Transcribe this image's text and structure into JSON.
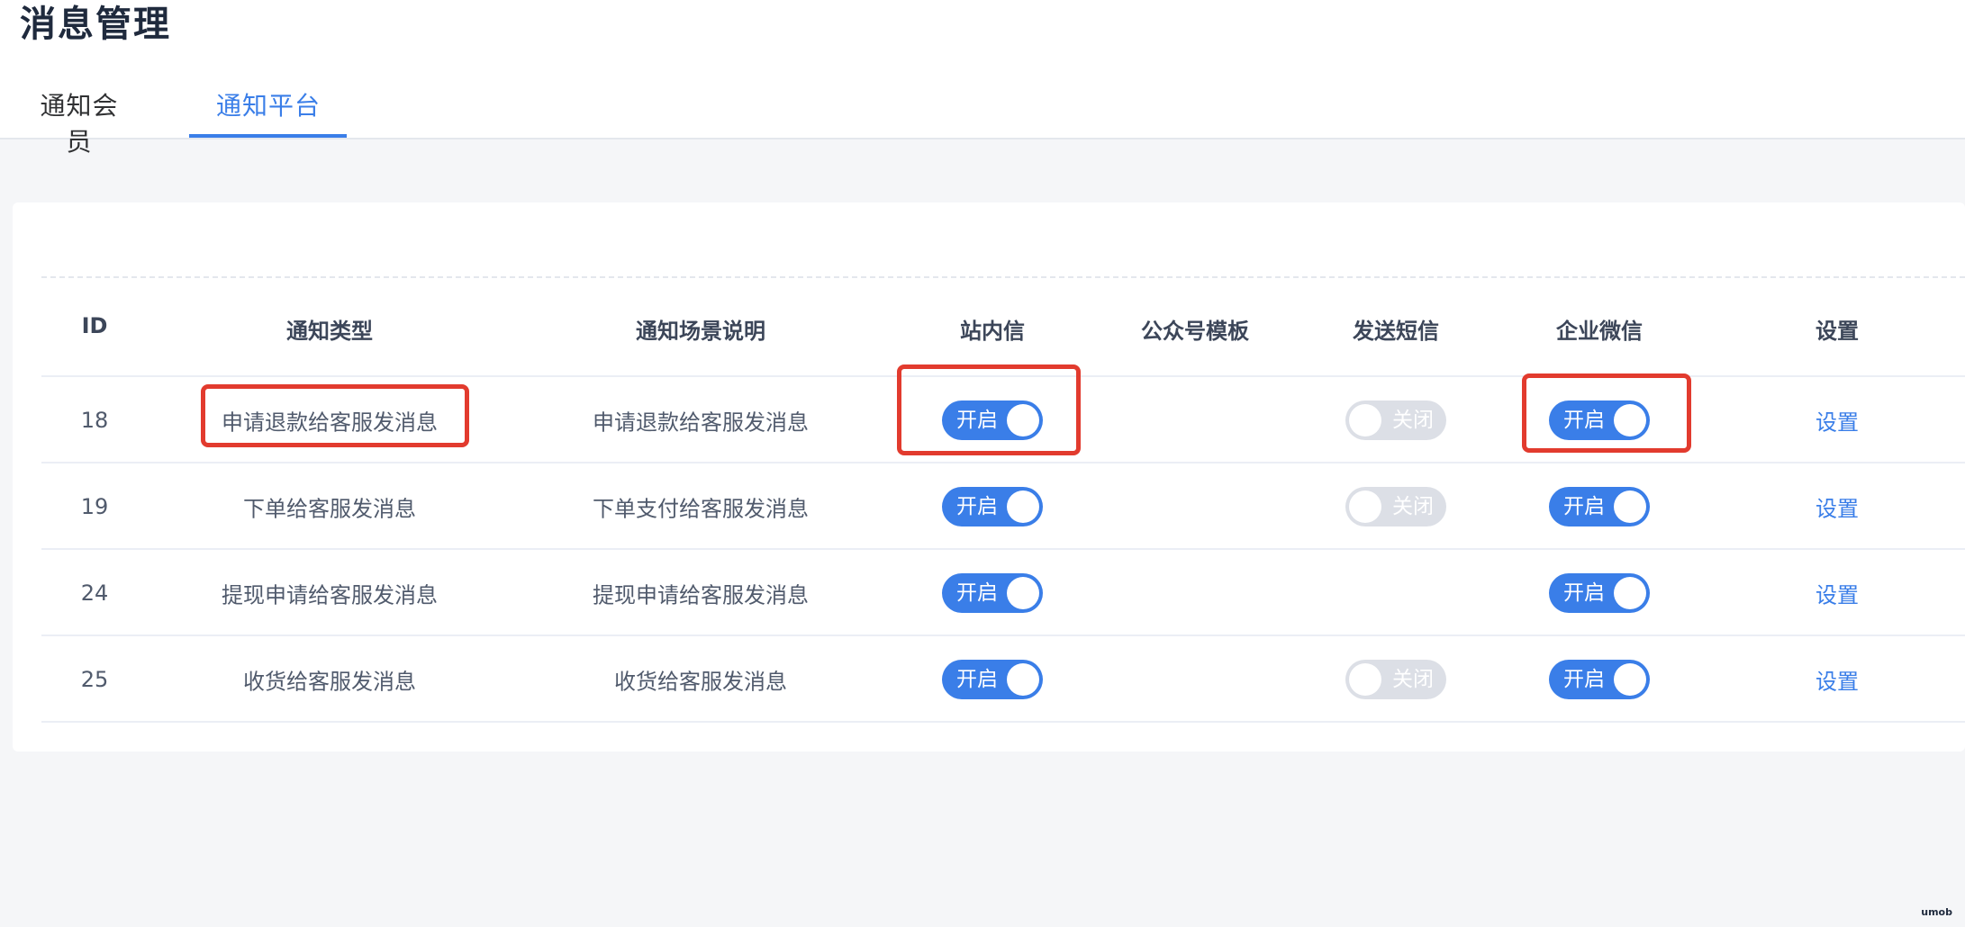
{
  "page": {
    "title": "消息管理"
  },
  "tabs": [
    {
      "label": "通知会员",
      "active": false
    },
    {
      "label": "通知平台",
      "active": true
    }
  ],
  "table": {
    "columns": [
      "ID",
      "通知类型",
      "通知场景说明",
      "站内信",
      "公众号模板",
      "发送短信",
      "企业微信",
      "设置"
    ],
    "rows": [
      {
        "id": "18",
        "type": "申请退款给客服发消息",
        "scene": "申请退款给客服发消息",
        "site_msg": "开启",
        "official_template": "",
        "sms": "关闭",
        "wecom": "开启",
        "action": "设置"
      },
      {
        "id": "19",
        "type": "下单给客服发消息",
        "scene": "下单支付给客服发消息",
        "site_msg": "开启",
        "official_template": "",
        "sms": "关闭",
        "wecom": "开启",
        "action": "设置"
      },
      {
        "id": "24",
        "type": "提现申请给客服发消息",
        "scene": "提现申请给客服发消息",
        "site_msg": "开启",
        "official_template": "",
        "sms": "",
        "wecom": "开启",
        "action": "设置"
      },
      {
        "id": "25",
        "type": "收货给客服发消息",
        "scene": "收货给客服发消息",
        "site_msg": "开启",
        "official_template": "",
        "sms": "关闭",
        "wecom": "开启",
        "action": "设置"
      }
    ]
  },
  "watermark": "umob",
  "colors": {
    "accent": "#3a7ee8",
    "switch_off": "#dcdfe6",
    "highlight": "#e23b2e"
  }
}
